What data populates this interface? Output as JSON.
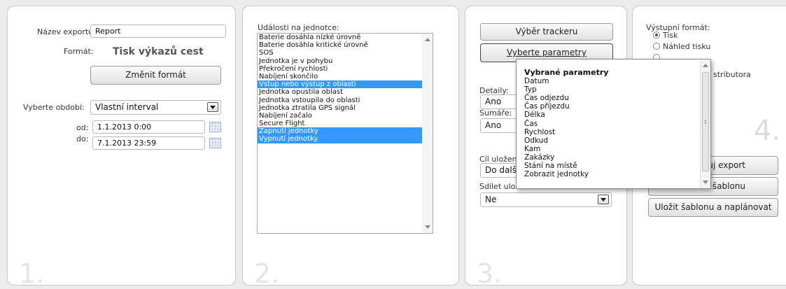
{
  "step1": {
    "export_name_label": "Název exportu:",
    "export_name_value": "Report",
    "format_label": "Formát:",
    "format_value": "Tisk výkazů cest",
    "change_format_button": "Změnit formát",
    "period_label": "Vyberte období:",
    "period_value": "Vlastní interval",
    "from_label": "od:",
    "from_value": "1.1.2013 0:00",
    "to_label": "do:",
    "to_value": "7.1.2013 23:59",
    "number": "1."
  },
  "step2": {
    "events_label": "Události na jednotce:",
    "events": [
      {
        "label": "Baterie dosáhla nízké úrovně",
        "selected": false
      },
      {
        "label": "Baterie dosáhla kritické úrovně",
        "selected": false
      },
      {
        "label": "SOS",
        "selected": false
      },
      {
        "label": "Jednotka je v pohybu",
        "selected": false
      },
      {
        "label": "Překročení rychlosti",
        "selected": false
      },
      {
        "label": "Nabíjení skončilo",
        "selected": false
      },
      {
        "label": "Vstup nebo výstup z oblasti",
        "selected": true
      },
      {
        "label": "Jednotka opustila oblast",
        "selected": false
      },
      {
        "label": "Jednotka vstoupila do oblasti",
        "selected": false
      },
      {
        "label": "Jednotka ztratila GPS signál",
        "selected": false
      },
      {
        "label": "Nabíjení začalo",
        "selected": false
      },
      {
        "label": "Secure Flight",
        "selected": false
      },
      {
        "label": "Zapnutí jednotky",
        "selected": true
      },
      {
        "label": "Vypnutí jednotky",
        "selected": true
      }
    ],
    "number": "2."
  },
  "step3": {
    "select_tracker_button": "Výběr trackeru",
    "select_params_button": "Vyberte parametry",
    "details_label": "Detaily:",
    "details_value": "Ano",
    "sums_label": "Sumáře:",
    "sums_value": "Ano",
    "target_label": "Cíl uložené",
    "target_value": "Do další",
    "share_label": "Sdílet ulož",
    "share_value": "Ne",
    "number": "3."
  },
  "params_popup": {
    "heading": "Vybrané parametry",
    "items": [
      "Datum",
      "Typ",
      "Čas odjezdu",
      "Čas příjezdu",
      "Délka",
      "Čas",
      "Rychlost",
      "Odkud",
      "Kam",
      "Zakázky",
      "Stání na místě",
      "Zobrazit jednotky"
    ]
  },
  "step4": {
    "output_label": "Výstupní formát:",
    "options": [
      "Tisk",
      "Náhled tisku"
    ],
    "partial_option": "stributora",
    "export_button_partial": "uj export",
    "template_button_partial": "šablonu",
    "save_schedule_button": "Uložit šablonu a naplánovat",
    "number": "4."
  },
  "colors": {
    "selection": "#3399ff",
    "panel_bg": "#ffffff",
    "page_bg": "#ececec"
  }
}
